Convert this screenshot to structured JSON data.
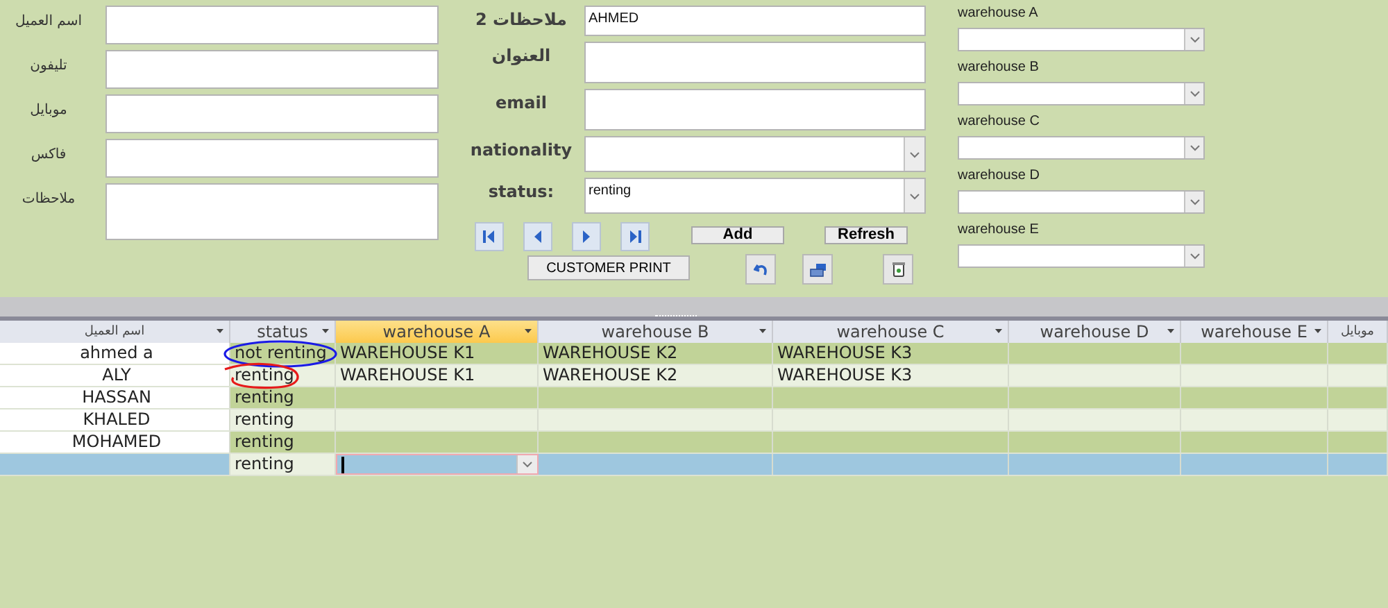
{
  "form": {
    "left_fields": [
      {
        "label": "اسم العميل",
        "kind": "text"
      },
      {
        "label": "تليفون",
        "kind": "text"
      },
      {
        "label": "موبايل",
        "kind": "text"
      },
      {
        "label": "فاكس",
        "kind": "text"
      },
      {
        "label": "ملاحظات",
        "kind": "memo"
      }
    ],
    "middle_fields": [
      {
        "label": "ملاحظات 2",
        "value": "AHMED",
        "kind": "text"
      },
      {
        "label": "العنوان",
        "kind": "text"
      },
      {
        "label": "email",
        "kind": "text"
      },
      {
        "label": "nationality",
        "kind": "combo"
      },
      {
        "label": "status:",
        "value": "renting",
        "kind": "combo"
      }
    ],
    "warehouses": [
      {
        "label": "warehouse A"
      },
      {
        "label": "warehouse B"
      },
      {
        "label": "warehouse C"
      },
      {
        "label": "warehouse D"
      },
      {
        "label": "warehouse E"
      }
    ],
    "add_button": "Add",
    "refresh_button": "Refresh",
    "print_button": "CUSTOMER PRINT"
  },
  "table": {
    "columns": [
      {
        "label": "اسم العميل",
        "selected": false
      },
      {
        "label": "status",
        "selected": false
      },
      {
        "label": "warehouse A",
        "selected": true
      },
      {
        "label": "warehouse B",
        "selected": false
      },
      {
        "label": "warehouse C",
        "selected": false
      },
      {
        "label": "warehouse D",
        "selected": false
      },
      {
        "label": "warehouse E",
        "selected": false
      },
      {
        "label": "موبايل",
        "selected": false
      }
    ],
    "rows": [
      {
        "cells": [
          "ahmed a",
          "not renting",
          "WAREHOUSE K1",
          "WAREHOUSE K2",
          "WAREHOUSE K3",
          null,
          null,
          null
        ],
        "selected": false,
        "color": "#1a1ae6"
      },
      {
        "cells": [
          "ALY",
          "renting",
          "WAREHOUSE K1",
          "WAREHOUSE K2",
          "WAREHOUSE K3",
          null,
          null,
          null
        ],
        "selected": false,
        "color": "#e61a1a"
      },
      {
        "cells": [
          "HASSAN",
          "renting",
          null,
          null,
          null,
          null,
          null,
          null
        ],
        "selected": false
      },
      {
        "cells": [
          "KHALED",
          "renting",
          null,
          null,
          null,
          null,
          null,
          null
        ],
        "selected": false
      },
      {
        "cells": [
          "MOHAMED",
          "renting",
          null,
          null,
          null,
          null,
          null,
          null
        ],
        "selected": false
      },
      {
        "cells": [
          null,
          "renting",
          null,
          null,
          null,
          null,
          null,
          null
        ],
        "selected": true
      }
    ]
  }
}
